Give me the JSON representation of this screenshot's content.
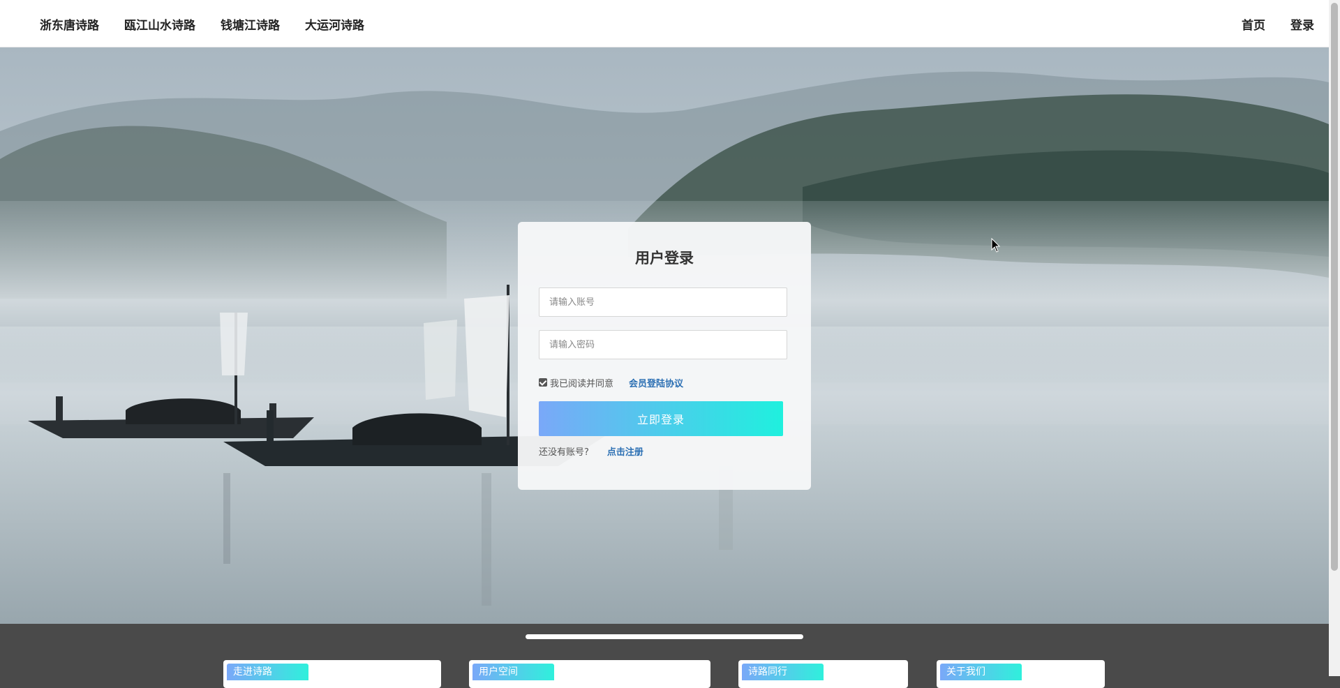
{
  "nav": {
    "left": [
      "浙东唐诗路",
      "瓯江山水诗路",
      "钱塘江诗路",
      "大运河诗路"
    ],
    "right": [
      "首页",
      "登录"
    ]
  },
  "login": {
    "title": "用户登录",
    "account_placeholder": "请输入账号",
    "password_placeholder": "请输入密码",
    "agree_checked": true,
    "agree_text": "我已阅读并同意",
    "agreement_link": "会员登陆协议",
    "submit_label": "立即登录",
    "register_prompt": "还没有账号?",
    "register_link": "点击注册"
  },
  "footer_tabs": [
    "走进诗路",
    "用户空间",
    "诗路同行",
    "关于我们"
  ],
  "colors": {
    "button_gradient_start": "#7aa8f8",
    "button_gradient_end": "#1ff0de",
    "link": "#2b6fb3",
    "footer_bg": "#4a4a4a"
  },
  "icons": {
    "checkbox": "checked-checkbox-icon",
    "cursor": "mouse-pointer-icon"
  }
}
